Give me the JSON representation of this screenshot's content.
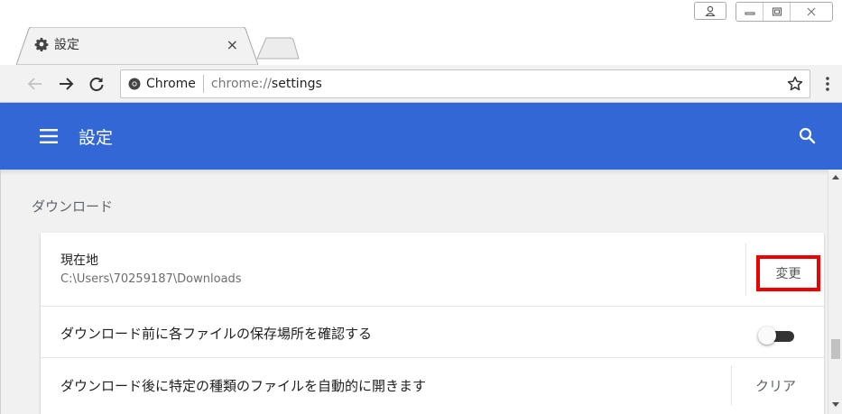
{
  "tab": {
    "title": "設定",
    "icon": "gear-icon",
    "close": "×"
  },
  "toolbar": {
    "site_name": "Chrome",
    "url_prefix": "chrome://",
    "url_path": "settings"
  },
  "header": {
    "title": "設定",
    "accent_color": "#3367d6"
  },
  "downloads": {
    "section_title": "ダウンロード",
    "location_label": "現在地",
    "location_path": "C:\\Users\\70259187\\Downloads",
    "change_button": "変更",
    "ask_label": "ダウンロード前に各ファイルの保存場所を確認する",
    "ask_enabled": false,
    "auto_open_label": "ダウンロード後に特定の種類のファイルを自動的に開きます",
    "clear_button": "クリア",
    "highlight_color": "#ee0000"
  }
}
